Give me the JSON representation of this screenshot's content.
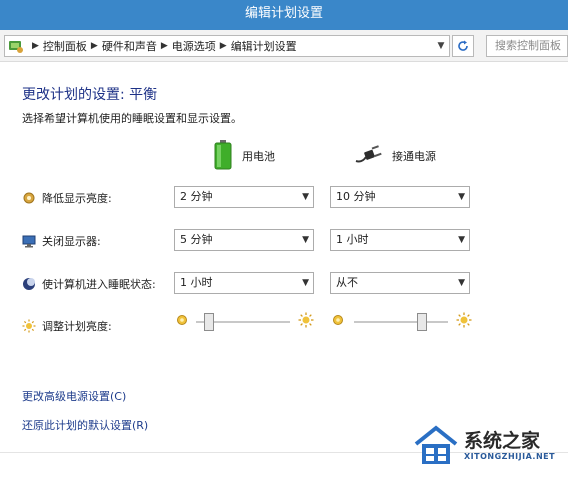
{
  "window": {
    "title": "编辑计划设置"
  },
  "address_bar": {
    "breadcrumbs": [
      "控制面板",
      "硬件和声音",
      "电源选项",
      "编辑计划设置"
    ],
    "search_placeholder": "搜索控制面板"
  },
  "content": {
    "title": "更改计划的设置: 平衡",
    "subtitle": "选择希望计算机使用的睡眠设置和显示设置。",
    "columns": {
      "battery": "用电池",
      "plugged": "接通电源"
    },
    "rows": [
      {
        "label": "降低显示亮度:",
        "battery": "2 分钟",
        "plugged": "10 分钟",
        "icon": "dim-display-icon"
      },
      {
        "label": "关闭显示器:",
        "battery": "5 分钟",
        "plugged": "1 小时",
        "icon": "monitor-icon"
      },
      {
        "label": "使计算机进入睡眠状态:",
        "battery": "1 小时",
        "plugged": "从不",
        "icon": "sleep-moon-icon"
      }
    ],
    "brightness": {
      "label": "调整计划亮度:",
      "battery_level": 0.1,
      "plugged_level": 0.75
    },
    "links": {
      "advanced": "更改高级电源设置(C)",
      "restore": "还原此计划的默认设置(R)"
    }
  },
  "watermark": {
    "title": "系统之家",
    "url": "XITONGZHIJIA.NET"
  },
  "colors": {
    "titlebar": "#3a87c9",
    "title_text": "#1e3287",
    "link": "#1e3c8c"
  }
}
